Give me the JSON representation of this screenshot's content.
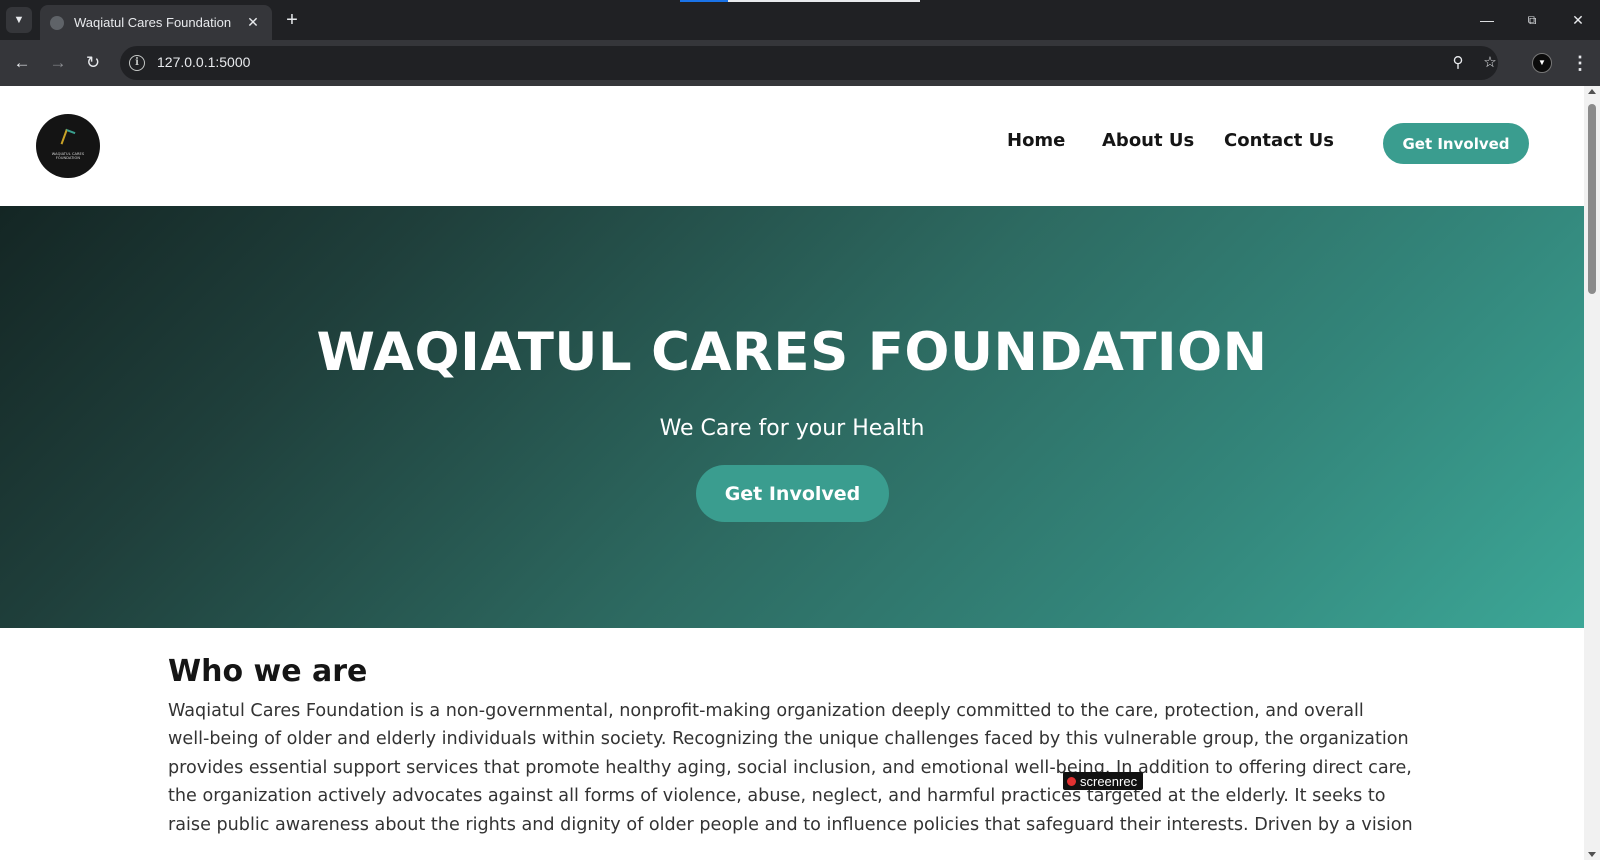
{
  "browser": {
    "tab_title": "Waqiatul Cares Foundation",
    "url": "127.0.0.1:5000",
    "icons": {
      "tab_list": "chevron-down-icon",
      "tab_close": "close-icon",
      "new_tab": "plus-icon",
      "back": "back-arrow-icon",
      "forward": "forward-arrow-icon",
      "reload": "reload-icon",
      "site_info": "info-icon",
      "zoom": "zoom-icon",
      "bookmark": "star-icon",
      "menu": "kebab-menu-icon"
    }
  },
  "header": {
    "logo_text": "WAQIATUL CARES FOUNDATION",
    "nav": [
      "Home",
      "About Us",
      "Contact Us"
    ],
    "cta_label": "Get Involved"
  },
  "hero": {
    "title": "WAQIATUL CARES FOUNDATION",
    "subtitle": "We Care for your Health",
    "cta_label": "Get Involved"
  },
  "about": {
    "heading": "Who we are",
    "lines": [
      "Waqiatul Cares Foundation is a non-governmental, nonprofit-making organization deeply committed to the care, protection, and overall",
      "well-being of older and elderly individuals within society. Recognizing the unique challenges faced by this vulnerable group, the organization",
      "provides essential support services that promote healthy aging, social inclusion, and emotional well-being. In addition to offering direct care,",
      "the organization actively advocates against all forms of violence, abuse, neglect, and harmful practices targeted at the elderly. It seeks to",
      "raise public awareness about the rights and dignity of older people and to influence policies that safeguard their interests. Driven by a vision"
    ]
  },
  "overlay": {
    "recorder_label": "screenrec"
  },
  "colors": {
    "accent": "#3a9d8f",
    "hero_dark": "#142624",
    "hero_light": "#3ca797"
  }
}
